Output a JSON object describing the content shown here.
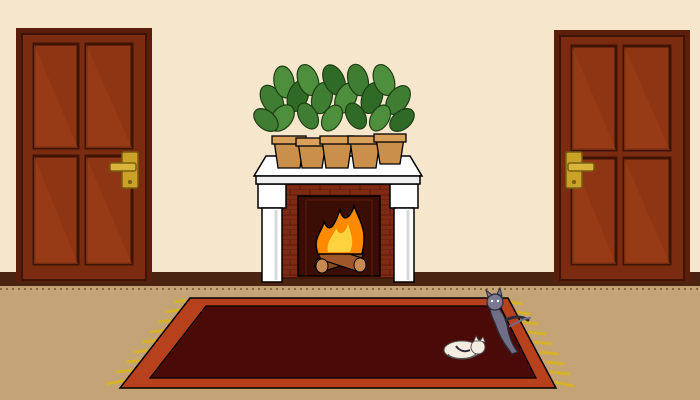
{
  "scene": {
    "colors": {
      "wall": "#f6e7cc",
      "floor": "#c4a377",
      "baseboard": "#4a2410",
      "door": "#7a2b10",
      "door_panel": "#8e3514",
      "handle": "#c9a227",
      "rug_outer": "#b8411d",
      "rug_inner": "#4a0a08",
      "fringe": "#d6b12a",
      "mantel": "#ffffff",
      "brick": "#7e2a14",
      "fire": "#ff8a00",
      "pot": "#c98f4b",
      "leaves": "#3f7d33"
    },
    "objects": {
      "left_door": "door-left",
      "right_door": "door-right",
      "plants": [
        "plant-pot-1",
        "plant-pot-2",
        "plant-pot-3",
        "plant-pot-4",
        "plant-pot-5"
      ],
      "fireplace": "fireplace",
      "rug": "rug",
      "gray_cat": "gray-cat",
      "white_cat": "sleeping-white-cat"
    }
  }
}
